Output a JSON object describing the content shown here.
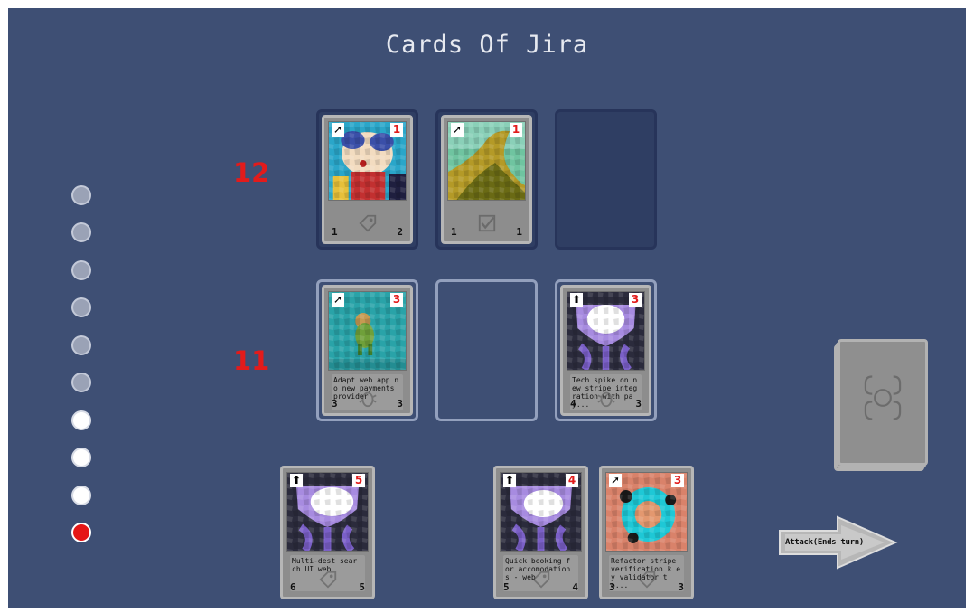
{
  "title": "Cards Of Jira",
  "opponent_health": "12",
  "player_health": "11",
  "mana": [
    "empty",
    "empty",
    "empty",
    "empty",
    "empty",
    "empty",
    "full",
    "full",
    "full",
    "current"
  ],
  "attack_button_label": "Attack(Ends turn)",
  "colors": {
    "background": "#3e4f74",
    "health": "#e21b1b",
    "card": "#8d8d8d"
  },
  "opponent_board": [
    {
      "type_icon": "arrow-diagonal-icon",
      "cost": "1",
      "attack": "1",
      "defense": "2",
      "art": "pixel-character",
      "ghost_icon": "tag-icon",
      "description": ""
    },
    {
      "type_icon": "arrow-diagonal-icon",
      "cost": "1",
      "attack": "1",
      "defense": "1",
      "art": "pixel-landscape",
      "ghost_icon": "checkbox-icon",
      "description": ""
    }
  ],
  "player_board": [
    {
      "type_icon": "arrow-diagonal-icon",
      "cost": "3",
      "attack": "3",
      "defense": "3",
      "art": "pixel-figure-teal",
      "ghost_icon": "bug-icon",
      "description": "Adapt web app n o new payments provider"
    },
    {
      "type_icon": "arrow-up-icon",
      "cost": "3",
      "attack": "4",
      "defense": "3",
      "art": "pixel-burst",
      "ghost_icon": "bug-icon",
      "description": "Tech spike on n ew stripe integ ration with pay..."
    }
  ],
  "hand": [
    {
      "type_icon": "arrow-up-icon",
      "cost": "5",
      "attack": "6",
      "defense": "5",
      "art": "pixel-burst",
      "ghost_icon": "tag-icon",
      "description": "Multi-dest sear ch UI web"
    },
    {
      "type_icon": "arrow-up-icon",
      "cost": "4",
      "attack": "5",
      "defense": "4",
      "art": "pixel-burst",
      "ghost_icon": "tag-icon",
      "description": "Quick booking f or accomodation s - web"
    },
    {
      "type_icon": "arrow-diagonal-icon",
      "cost": "3",
      "attack": "3",
      "defense": "3",
      "art": "pixel-ring",
      "ghost_icon": "tag-icon",
      "description": "Refactor stripe verification k ey validator to..."
    }
  ]
}
